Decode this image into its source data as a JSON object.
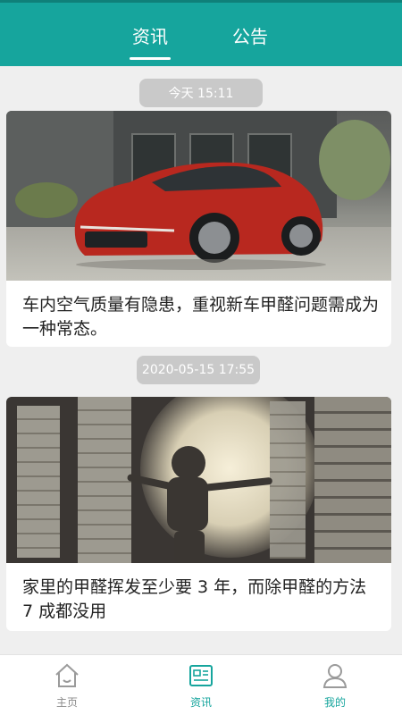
{
  "header": {
    "tabs": [
      {
        "label": "资讯",
        "active": true
      },
      {
        "label": "公告",
        "active": false
      }
    ],
    "color": "#16a59d"
  },
  "feed": [
    {
      "time": "今天 15:11",
      "title": "车内空气质量有隐患，重视新车甲醛问题需成为一种常态。",
      "image": "red-car-photo"
    },
    {
      "time": "2020-05-15 17:55",
      "title": "家里的甲醛挥发至少要 3 年，而除甲醛的方法 7 成都没用",
      "image": "child-at-window-photo"
    }
  ],
  "tabbar": {
    "items": [
      {
        "label": "主页",
        "icon": "home-icon",
        "active": false
      },
      {
        "label": "资讯",
        "icon": "news-icon",
        "active": true
      },
      {
        "label": "我的",
        "icon": "user-icon",
        "active": false
      }
    ],
    "active_color": "#16a59d",
    "inactive_color": "#8a8a8a"
  }
}
